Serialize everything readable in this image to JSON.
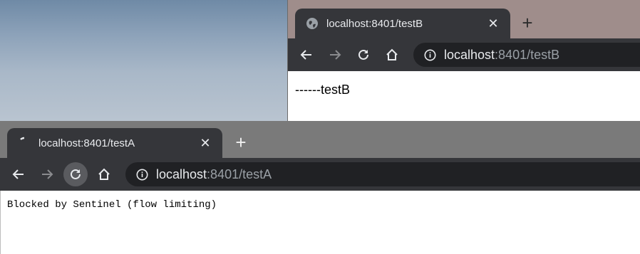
{
  "window_b": {
    "tab_title": "localhost:8401/testB",
    "url_host": "localhost",
    "url_rest": ":8401/testB",
    "body_text": "------testB"
  },
  "window_a": {
    "tab_title": "localhost:8401/testA",
    "url_host": "localhost",
    "url_rest": ":8401/testA",
    "body_text": "Blocked by Sentinel (flow limiting)"
  },
  "icons": {
    "tab_b_favicon": "globe-icon",
    "tab_a_favicon": "loading-spinner-icon",
    "close": "close-icon",
    "new_tab": "plus-icon",
    "back": "back-arrow-icon",
    "forward": "forward-arrow-icon",
    "reload": "reload-icon",
    "home": "home-icon",
    "site_info": "info-icon"
  },
  "colors": {
    "tab_bg": "#35363a",
    "omnibox_bg": "#202124",
    "text_light": "#e8eaed",
    "text_muted": "#9aa0a6"
  }
}
